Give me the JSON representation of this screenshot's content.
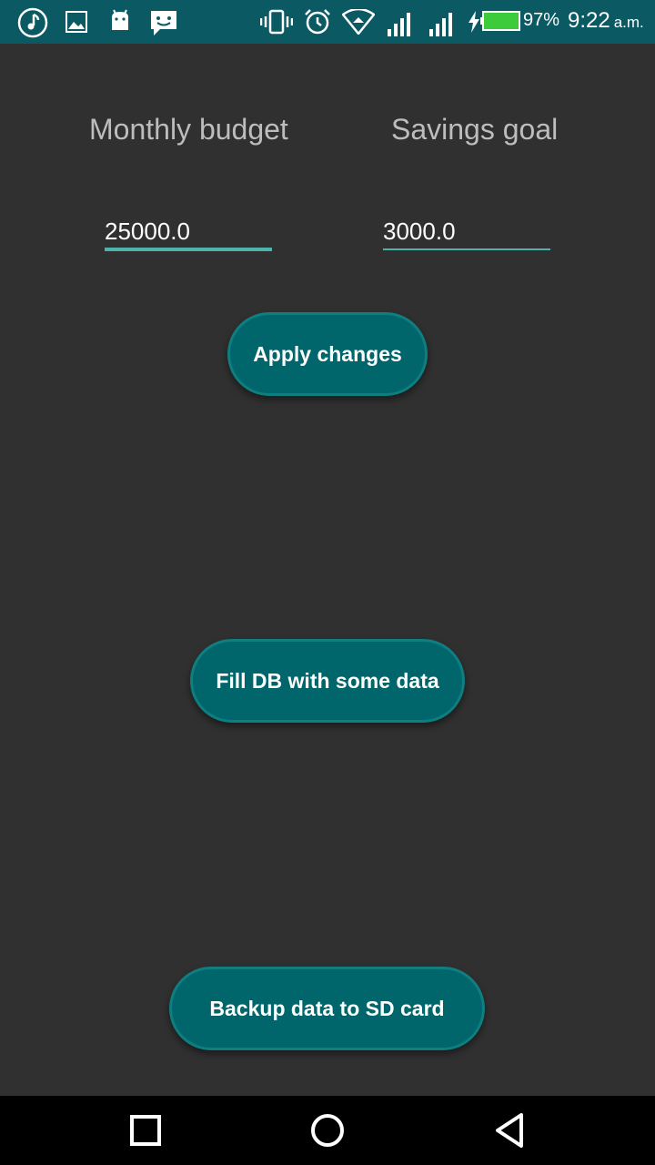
{
  "status_bar": {
    "battery_percent": "97%",
    "time": "9:22",
    "time_suffix": "a.m.",
    "icons": [
      "music-note-icon",
      "image-icon",
      "android-icon",
      "chat-icon",
      "vibrate-icon",
      "alarm-icon",
      "wifi-icon",
      "signal-icon",
      "signal-icon",
      "charging-icon",
      "battery-icon"
    ]
  },
  "settings": {
    "monthly_budget_label": "Monthly budget",
    "savings_goal_label": "Savings goal",
    "monthly_budget_value": "25000.0",
    "savings_goal_value": "3000.0"
  },
  "buttons": {
    "apply": "Apply changes",
    "fill_db": "Fill DB with some data",
    "backup": "Backup data to SD card"
  },
  "colors": {
    "background": "#303030",
    "status_bar": "#0b5a63",
    "accent": "#4fb3ad",
    "button": "#00666b"
  }
}
